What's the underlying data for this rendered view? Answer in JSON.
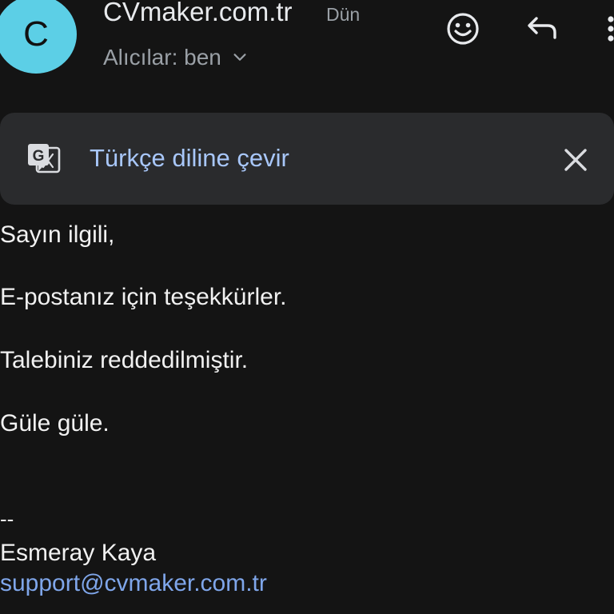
{
  "header": {
    "avatar_letter": "C",
    "sender": "CVmaker.com.tr",
    "date": "Dün",
    "recipients": "Alıcılar: ben",
    "icons": {
      "emoji": "emoji-reaction-icon",
      "reply": "reply-icon",
      "more": "more-vert-icon",
      "expand": "chevron-down-icon"
    }
  },
  "translate_banner": {
    "text": "Türkçe diline çevir",
    "icon": "google-translate-icon",
    "close": "close-icon"
  },
  "body": {
    "greeting": "Sayın ilgili,",
    "line1": "E-postanız için teşekkürler.",
    "line2": "Talebiniz reddedilmiştir.",
    "line3": "Güle güle."
  },
  "signature": {
    "separator": "--",
    "name": "Esmeray Kaya",
    "email": "support@cvmaker.com.tr"
  },
  "colors": {
    "background": "#141414",
    "avatar": "#5ccfe6",
    "banner": "#2a2b2d",
    "link": "#a8c7fa"
  }
}
